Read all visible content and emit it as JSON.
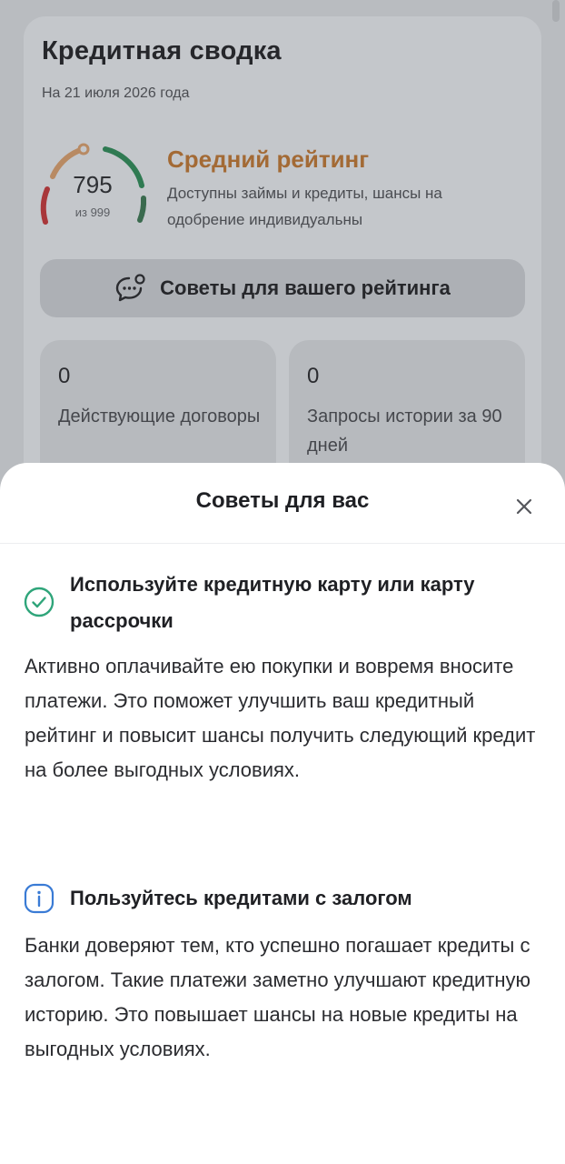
{
  "summary": {
    "title": "Кредитная сводка",
    "date": "На 21 июля 2026 года",
    "score": "795",
    "score_max": "из 999",
    "rating_title": "Средний рейтинг",
    "rating_description": "Доступны займы и кредиты, шансы на одобрение индивидуальны",
    "rating_color": "#a36a35",
    "score_fraction": 0.795,
    "tips_button_label": "Советы для вашего рейтинга",
    "stats": [
      {
        "value": "0",
        "label": "Действующие договоры"
      },
      {
        "value": "0",
        "label": "Запросы истории за 90 дней"
      }
    ]
  },
  "sheet": {
    "title": "Советы для вас",
    "tips": [
      {
        "icon": "check-circle-icon",
        "icon_color": "#2fa57a",
        "heading": "Используйте кредитную карту или карту рассрочки",
        "body": "Активно оплачивайте ею покупки и вовремя вносите платежи. Это поможет улучшить ваш кредитный рейтинг и повысит шансы получить следующий кредит на более выгодных условиях."
      },
      {
        "icon": "info-icon",
        "icon_color": "#3a7bd5",
        "heading": "Пользуйтесь кредитами с залогом",
        "body": "Банки доверяют тем, кто успешно погашает кредиты с залогом. Такие платежи заметно улучшают кредитную историю. Это повышает шансы на новые кредиты на выгодных условиях."
      }
    ]
  }
}
